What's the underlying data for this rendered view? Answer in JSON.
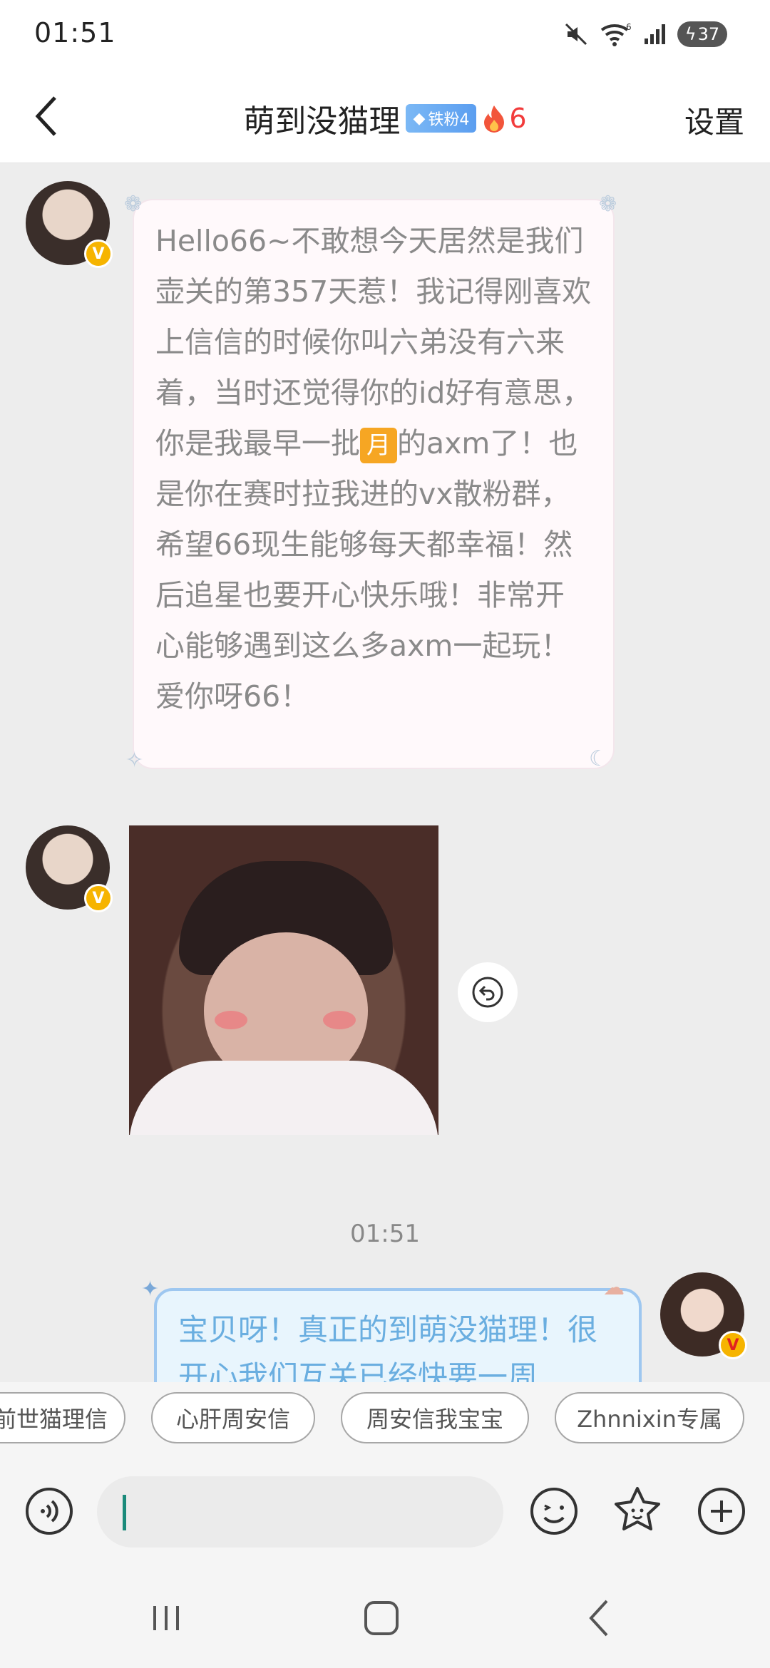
{
  "status": {
    "time": "01:51",
    "battery": "37",
    "wifi_label": "6"
  },
  "header": {
    "back_icon": "chevron-left-icon",
    "title": "萌到没猫理",
    "fan_badge": "铁粉4",
    "fire_count": "6",
    "settings_label": "设置"
  },
  "messages": {
    "first": {
      "text_before": "Hello66~不敢想今天居然是我们壶关的第357天惹！我记得刚喜欢上信信的时候你叫六弟没有六来着，当时还觉得你的id好有意思，你是我最早一批",
      "emoji_label": "月",
      "text_after": "的axm了！也是你在赛时拉我进的vx散粉群，希望66现生能够每天都幸福！然后追星也要开心快乐哦！非常开心能够遇到这么多axm一起玩！爱你呀66！"
    },
    "timestamp": "01:51",
    "reply_text": "宝贝呀！真正的到萌没猫理！很开心我们互关已经快要一周"
  },
  "quick_replies": [
    "前世猫理信",
    "心肝周安信",
    "周安信我宝宝",
    "Zhnnixin专属"
  ],
  "input": {
    "value": ""
  },
  "colors": {
    "accent_teal": "#1a8a7a",
    "fire": "#f23b3b",
    "badge_blue": "#5b9ef0",
    "verified": "#f6b400"
  }
}
